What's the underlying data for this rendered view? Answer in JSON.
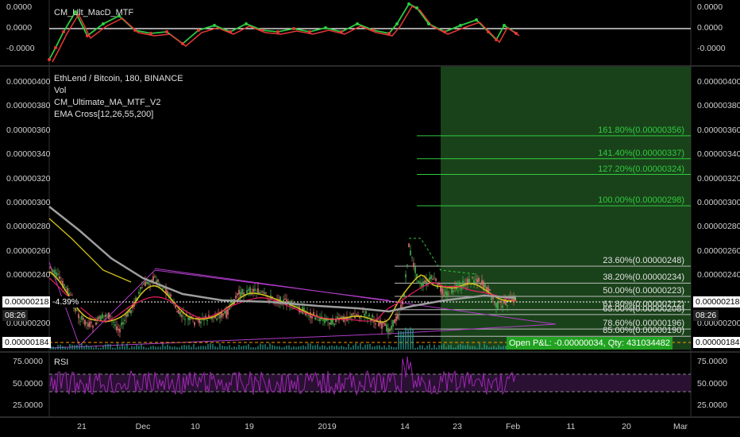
{
  "macd": {
    "title": "CM_Ult_MacD_MTF",
    "axis_left": [
      "0.0000",
      "0.0000",
      "-0.0000"
    ],
    "axis_right": [
      "0.0000",
      "0.0000",
      "-0.0000"
    ]
  },
  "main": {
    "legend": [
      "EthLend / Bitcoin, 180, BINANCE",
      "Vol",
      "CM_Ultimate_MA_MTF_V2",
      "EMA Cross[12,26,55,200]"
    ],
    "price_axis": [
      "0.00000400",
      "0.00000380",
      "0.00000360",
      "0.00000340",
      "0.00000320",
      "0.00000300",
      "0.00000280",
      "0.00000260",
      "0.00000240",
      "0.00000200"
    ],
    "last_price": "0.00000218",
    "change": "-4.39%",
    "countdown": "08:26",
    "stop_price": "0.00000184",
    "fib_levels": [
      {
        "label": "161.80%(0.00000356)"
      },
      {
        "label": "141.40%(0.00000337)"
      },
      {
        "label": "127.20%(0.00000324)"
      },
      {
        "label": "100.00%(0.00000298)"
      },
      {
        "label": "23.60%(0.00000248)"
      },
      {
        "label": "38.20%(0.00000234)"
      },
      {
        "label": "50.00%(0.00000223)"
      },
      {
        "label": "61.80%(0.00000212)"
      },
      {
        "label": "65.00%(0.00000208)"
      },
      {
        "label": "78.60%(0.00000196)"
      },
      {
        "label": "85.00%(0.00000190)"
      }
    ],
    "position": "Open P&L: -0.00000034, Qty: 431034482"
  },
  "rsi": {
    "title": "RSI",
    "axis": [
      "75.0000",
      "50.0000",
      "25.0000"
    ]
  },
  "time_axis": [
    "21",
    "Dec",
    "10",
    "19",
    "2019",
    "14",
    "23",
    "Feb",
    "11",
    "20",
    "Mar"
  ],
  "colors": {
    "bg": "#000000",
    "up": "#26a69a",
    "fib": "#2ecc40",
    "zone": "#1f4d1f",
    "rsi_band": "#2a1033",
    "position": "#21a321",
    "stop": "#ff9800"
  }
}
